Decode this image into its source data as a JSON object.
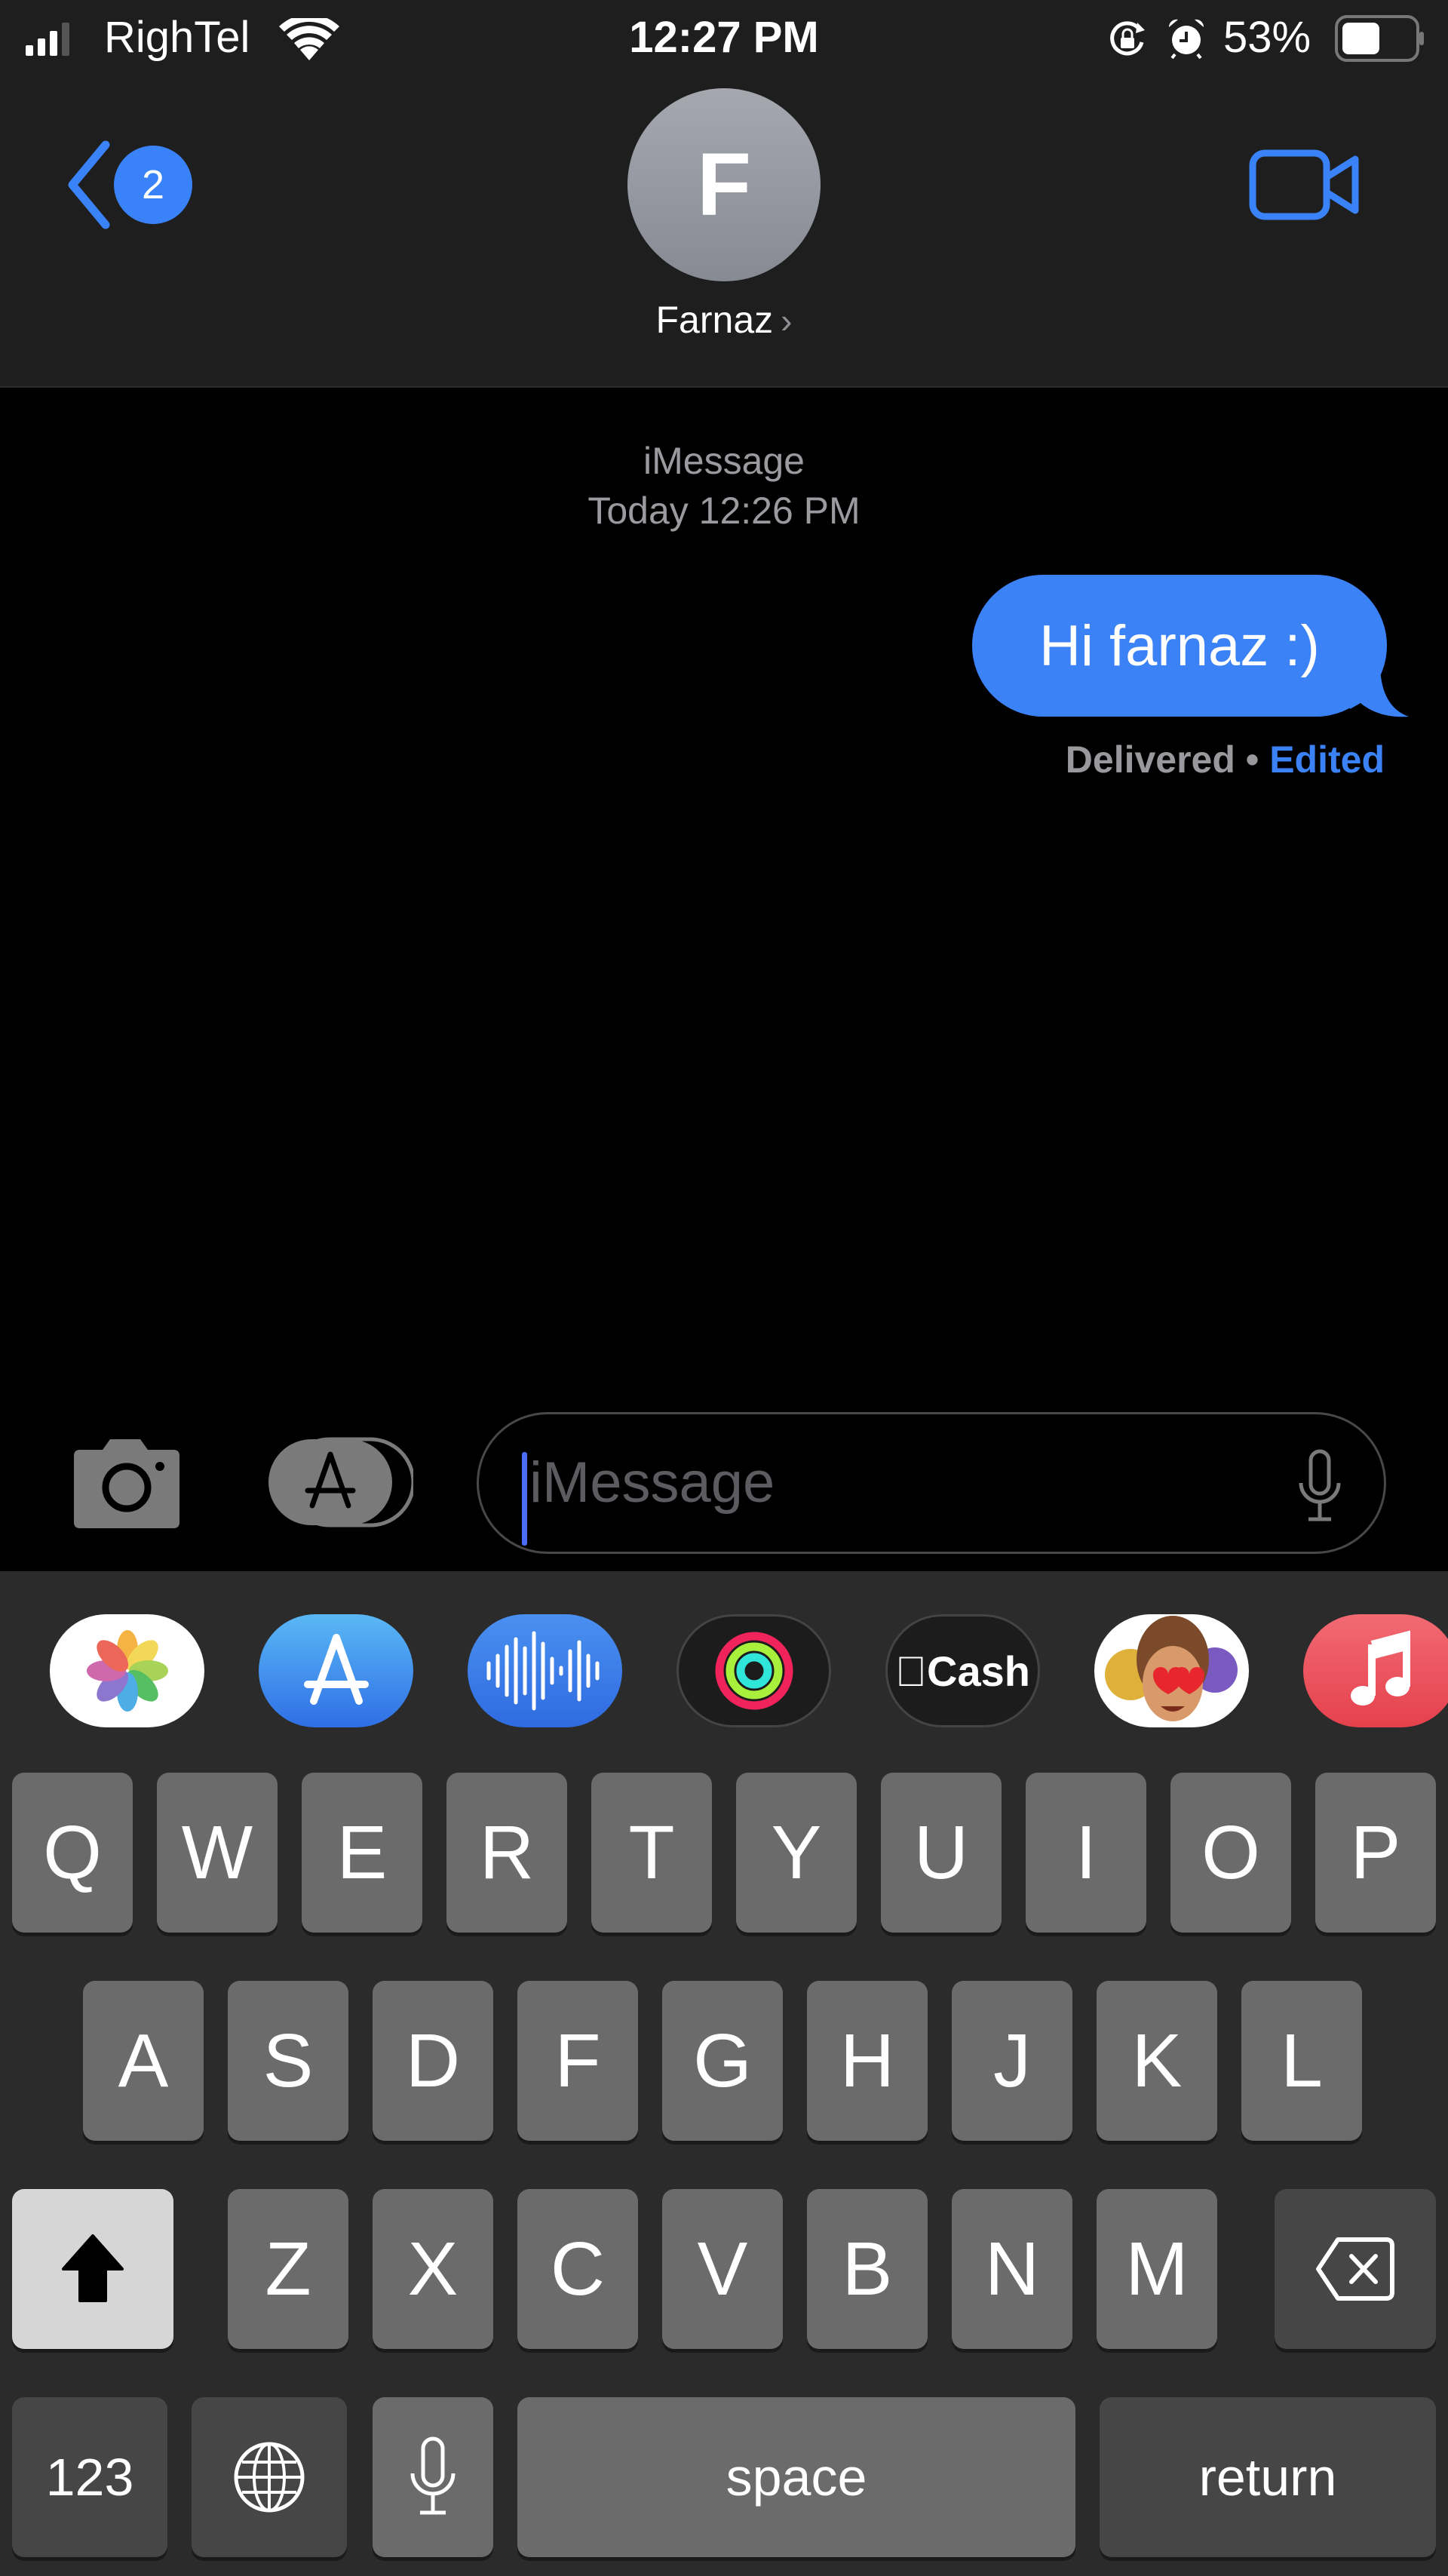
{
  "status_bar": {
    "carrier": "RighTel",
    "time": "12:27 PM",
    "battery_percent": "53%",
    "battery_level": 0.53,
    "signal_bars_active": 3,
    "icons": [
      "cellular-signal-icon",
      "wifi-icon",
      "orientation-lock-icon",
      "alarm-icon",
      "battery-icon"
    ]
  },
  "header": {
    "back_badge_count": "2",
    "avatar_initial": "F",
    "contact_name": "Farnaz",
    "contact_chevron": "›",
    "video_icon": "video-camera-icon"
  },
  "conversation": {
    "service_label": "iMessage",
    "timestamp": "Today 12:26 PM",
    "messages": [
      {
        "direction": "outgoing",
        "text": "Hi farnaz :)"
      }
    ],
    "delivery_status": "Delivered",
    "separator": " • ",
    "edited_label": "Edited"
  },
  "compose": {
    "placeholder": "iMessage",
    "value": "",
    "camera_icon": "camera-icon",
    "apps_icon": "app-store-icon",
    "dictate_icon": "microphone-icon"
  },
  "app_strip": [
    {
      "name": "Photos",
      "icon": "photos-icon"
    },
    {
      "name": "App Store",
      "icon": "app-store-icon"
    },
    {
      "name": "Audio Message",
      "icon": "waveform-icon"
    },
    {
      "name": "Activity",
      "icon": "activity-rings-icon"
    },
    {
      "name": "Apple Cash",
      "icon": "apple-cash-icon",
      "label": "Cash"
    },
    {
      "name": "Memoji Stickers",
      "icon": "memoji-icon"
    },
    {
      "name": "Music",
      "icon": "music-icon"
    }
  ],
  "keyboard": {
    "row1": [
      "Q",
      "W",
      "E",
      "R",
      "T",
      "Y",
      "U",
      "I",
      "O",
      "P"
    ],
    "row2": [
      "A",
      "S",
      "D",
      "F",
      "G",
      "H",
      "J",
      "K",
      "L"
    ],
    "row3": [
      "Z",
      "X",
      "C",
      "V",
      "B",
      "N",
      "M"
    ],
    "shift_icon": "shift-arrow-icon",
    "delete_icon": "delete-backspace-icon",
    "numbers_label": "123",
    "globe_icon": "globe-icon",
    "mic_icon": "microphone-icon",
    "space_label": "space",
    "return_label": "return"
  }
}
